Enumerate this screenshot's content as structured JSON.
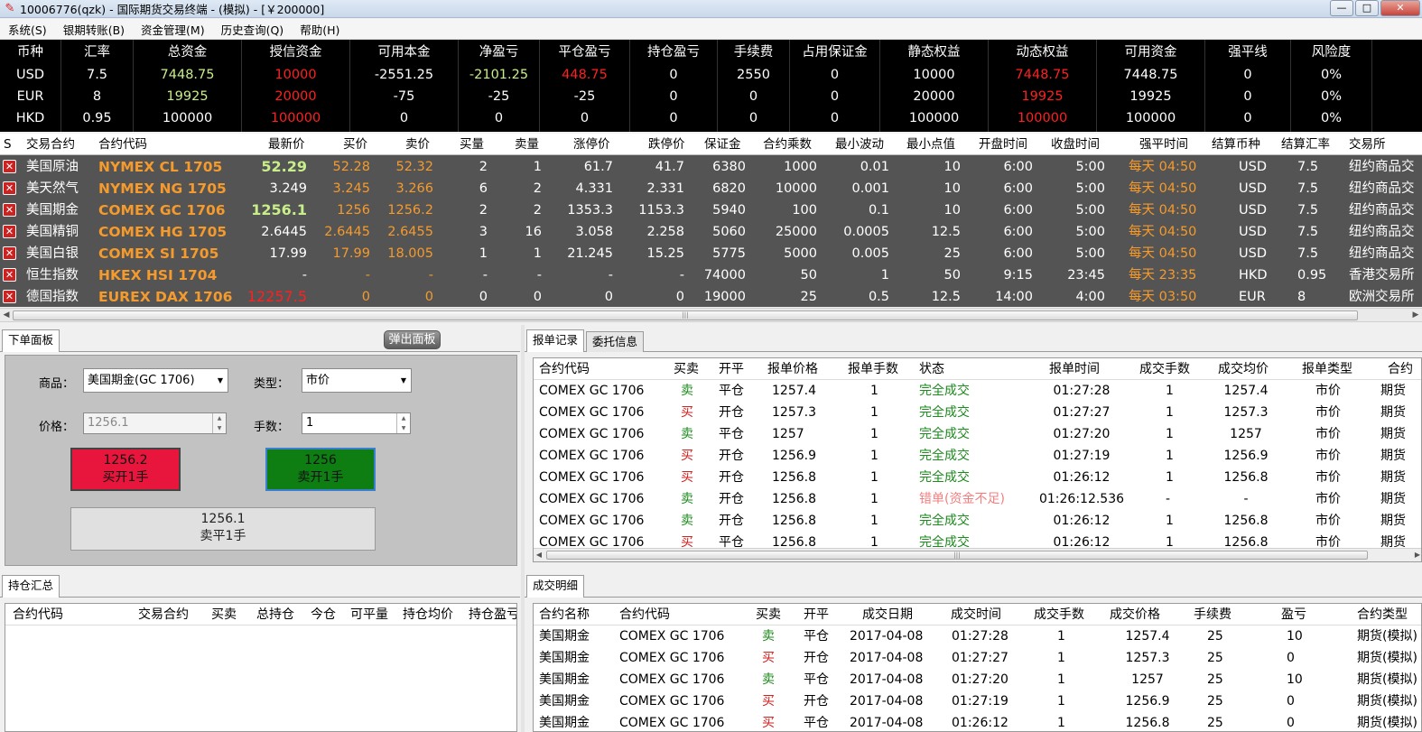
{
  "window": {
    "title": "10006776(qzk) - 国际期货交易终端 - (模拟) - [￥200000]"
  },
  "menu": [
    "系统(S)",
    "银期转账(B)",
    "资金管理(M)",
    "历史查询(Q)",
    "帮助(H)"
  ],
  "account": {
    "headers": [
      "币种",
      "汇率",
      "总资金",
      "授信资金",
      "可用本金",
      "净盈亏",
      "平仓盈亏",
      "持仓盈亏",
      "手续费",
      "占用保证金",
      "静态权益",
      "动态权益",
      "可用资金",
      "强平线",
      "风险度"
    ],
    "rows": [
      [
        "USD",
        "7.5",
        "7448.75",
        "10000",
        "-2551.25",
        "-2101.25",
        "448.75",
        "0",
        "2550",
        "0",
        "10000",
        "7448.75",
        "7448.75",
        "0",
        "0%"
      ],
      [
        "EUR",
        "8",
        "19925",
        "20000",
        "-75",
        "-25",
        "-25",
        "0",
        "0",
        "0",
        "20000",
        "19925",
        "19925",
        "0",
        "0%"
      ],
      [
        "HKD",
        "0.95",
        "100000",
        "100000",
        "0",
        "0",
        "0",
        "0",
        "0",
        "0",
        "100000",
        "100000",
        "100000",
        "0",
        "0%"
      ]
    ]
  },
  "quotes": {
    "headers": [
      "S",
      "交易合约",
      "合约代码",
      "最新价",
      "买价",
      "卖价",
      "买量",
      "卖量",
      "涨停价",
      "跌停价",
      "保证金",
      "合约乘数",
      "最小波动",
      "最小点值",
      "开盘时间",
      "收盘时间",
      "强平时间",
      "结算币种",
      "结算汇率",
      "交易所"
    ],
    "rows": [
      {
        "name": "美国原油",
        "code": "NYMEX CL 1705",
        "last": "52.29",
        "bid": "52.28",
        "ask": "52.32",
        "bidv": "2",
        "askv": "1",
        "up": "61.7",
        "down": "41.7",
        "margin": "6380",
        "mult": "1000",
        "tick": "0.01",
        "tickval": "10",
        "open": "6:00",
        "close": "5:00",
        "liq": "每天 04:50",
        "cur": "USD",
        "rate": "7.5",
        "exch": "纽约商品交"
      },
      {
        "name": "美天然气",
        "code": "NYMEX NG 1705",
        "last": "3.249",
        "bid": "3.245",
        "ask": "3.266",
        "bidv": "6",
        "askv": "2",
        "up": "4.331",
        "down": "2.331",
        "margin": "6820",
        "mult": "10000",
        "tick": "0.001",
        "tickval": "10",
        "open": "6:00",
        "close": "5:00",
        "liq": "每天 04:50",
        "cur": "USD",
        "rate": "7.5",
        "exch": "纽约商品交"
      },
      {
        "name": "美国期金",
        "code": "COMEX GC 1706",
        "last": "1256.1",
        "bid": "1256",
        "ask": "1256.2",
        "bidv": "2",
        "askv": "2",
        "up": "1353.3",
        "down": "1153.3",
        "margin": "5940",
        "mult": "100",
        "tick": "0.1",
        "tickval": "10",
        "open": "6:00",
        "close": "5:00",
        "liq": "每天 04:50",
        "cur": "USD",
        "rate": "7.5",
        "exch": "纽约商品交"
      },
      {
        "name": "美国精铜",
        "code": "COMEX HG 1705",
        "last": "2.6445",
        "bid": "2.6445",
        "ask": "2.6455",
        "bidv": "3",
        "askv": "16",
        "up": "3.058",
        "down": "2.258",
        "margin": "5060",
        "mult": "25000",
        "tick": "0.0005",
        "tickval": "12.5",
        "open": "6:00",
        "close": "5:00",
        "liq": "每天 04:50",
        "cur": "USD",
        "rate": "7.5",
        "exch": "纽约商品交"
      },
      {
        "name": "美国白银",
        "code": "COMEX SI 1705",
        "last": "17.99",
        "bid": "17.99",
        "ask": "18.005",
        "bidv": "1",
        "askv": "1",
        "up": "21.245",
        "down": "15.25",
        "margin": "5775",
        "mult": "5000",
        "tick": "0.005",
        "tickval": "25",
        "open": "6:00",
        "close": "5:00",
        "liq": "每天 04:50",
        "cur": "USD",
        "rate": "7.5",
        "exch": "纽约商品交"
      },
      {
        "name": "恒生指数",
        "code": "HKEX HSI 1704",
        "last": "-",
        "bid": "-",
        "ask": "-",
        "bidv": "-",
        "askv": "-",
        "up": "-",
        "down": "-",
        "margin": "74000",
        "mult": "50",
        "tick": "1",
        "tickval": "50",
        "open": "9:15",
        "close": "23:45",
        "liq": "每天 23:35",
        "cur": "HKD",
        "rate": "0.95",
        "exch": "香港交易所"
      },
      {
        "name": "德国指数",
        "code": "EUREX DAX 1706",
        "last": "12257.5",
        "bid": "0",
        "ask": "0",
        "bidv": "0",
        "askv": "0",
        "up": "0",
        "down": "0",
        "margin": "19000",
        "mult": "25",
        "tick": "0.5",
        "tickval": "12.5",
        "open": "14:00",
        "close": "4:00",
        "liq": "每天 03:50",
        "cur": "EUR",
        "rate": "8",
        "exch": "欧洲交易所"
      }
    ]
  },
  "order_panel": {
    "tab": "下单面板",
    "popout": "弹出面板",
    "product_label": "商品：",
    "product_value": "美国期金(GC 1706)",
    "type_label": "类型：",
    "type_value": "市价",
    "price_label": "价格：",
    "price_value": "1256.1",
    "qty_label": "手数：",
    "qty_value": "1",
    "buy_price": "1256.2",
    "buy_label": "买开1手",
    "sell_price": "1256",
    "sell_label": "卖开1手",
    "close_price": "1256.1",
    "close_label": "卖平1手"
  },
  "orders": {
    "tabs": [
      "报单记录",
      "委托信息"
    ],
    "headers": [
      "合约代码",
      "买卖",
      "开平",
      "报单价格",
      "报单手数",
      "状态",
      "报单时间",
      "成交手数",
      "成交均价",
      "报单类型",
      "合约"
    ],
    "rows": [
      [
        "COMEX GC 1706",
        "卖",
        "平仓",
        "1257.4",
        "1",
        "完全成交",
        "01:27:28",
        "1",
        "1257.4",
        "市价",
        "期货"
      ],
      [
        "COMEX GC 1706",
        "买",
        "开仓",
        "1257.3",
        "1",
        "完全成交",
        "01:27:27",
        "1",
        "1257.3",
        "市价",
        "期货"
      ],
      [
        "COMEX GC 1706",
        "卖",
        "平仓",
        "1257",
        "1",
        "完全成交",
        "01:27:20",
        "1",
        "1257",
        "市价",
        "期货"
      ],
      [
        "COMEX GC 1706",
        "买",
        "开仓",
        "1256.9",
        "1",
        "完全成交",
        "01:27:19",
        "1",
        "1256.9",
        "市价",
        "期货"
      ],
      [
        "COMEX GC 1706",
        "买",
        "开仓",
        "1256.8",
        "1",
        "完全成交",
        "01:26:12",
        "1",
        "1256.8",
        "市价",
        "期货"
      ],
      [
        "COMEX GC 1706",
        "卖",
        "开仓",
        "1256.8",
        "1",
        "错单(资金不足)",
        "01:26:12.536",
        "-",
        "-",
        "市价",
        "期货"
      ],
      [
        "COMEX GC 1706",
        "卖",
        "开仓",
        "1256.8",
        "1",
        "完全成交",
        "01:26:12",
        "1",
        "1256.8",
        "市价",
        "期货"
      ],
      [
        "COMEX GC 1706",
        "买",
        "平仓",
        "1256.8",
        "1",
        "完全成交",
        "01:26:12",
        "1",
        "1256.8",
        "市价",
        "期货"
      ]
    ]
  },
  "positions": {
    "tab": "持仓汇总",
    "headers": [
      "合约代码",
      "交易合约",
      "买卖",
      "总持仓",
      "今仓",
      "可平量",
      "持仓均价",
      "持仓盈亏"
    ]
  },
  "trades": {
    "tab": "成交明细",
    "headers": [
      "合约名称",
      "合约代码",
      "买卖",
      "开平",
      "成交日期",
      "成交时间",
      "成交手数",
      "成交价格",
      "手续费",
      "盈亏",
      "合约类型"
    ],
    "rows": [
      [
        "美国期金",
        "COMEX GC 1706",
        "卖",
        "平仓",
        "2017-04-08",
        "01:27:28",
        "1",
        "1257.4",
        "25",
        "10",
        "期货(模拟)"
      ],
      [
        "美国期金",
        "COMEX GC 1706",
        "买",
        "开仓",
        "2017-04-08",
        "01:27:27",
        "1",
        "1257.3",
        "25",
        "0",
        "期货(模拟)"
      ],
      [
        "美国期金",
        "COMEX GC 1706",
        "卖",
        "平仓",
        "2017-04-08",
        "01:27:20",
        "1",
        "1257",
        "25",
        "10",
        "期货(模拟)"
      ],
      [
        "美国期金",
        "COMEX GC 1706",
        "买",
        "开仓",
        "2017-04-08",
        "01:27:19",
        "1",
        "1256.9",
        "25",
        "0",
        "期货(模拟)"
      ],
      [
        "美国期金",
        "COMEX GC 1706",
        "买",
        "平仓",
        "2017-04-08",
        "01:26:12",
        "1",
        "1256.8",
        "25",
        "0",
        "期货(模拟)"
      ]
    ]
  },
  "colors": {
    "buy_button": "#e8163c",
    "sell_button": "#0e7d12",
    "quote_bg": "#545454",
    "account_bg": "#000000",
    "price_orange": "#f59a2c"
  }
}
